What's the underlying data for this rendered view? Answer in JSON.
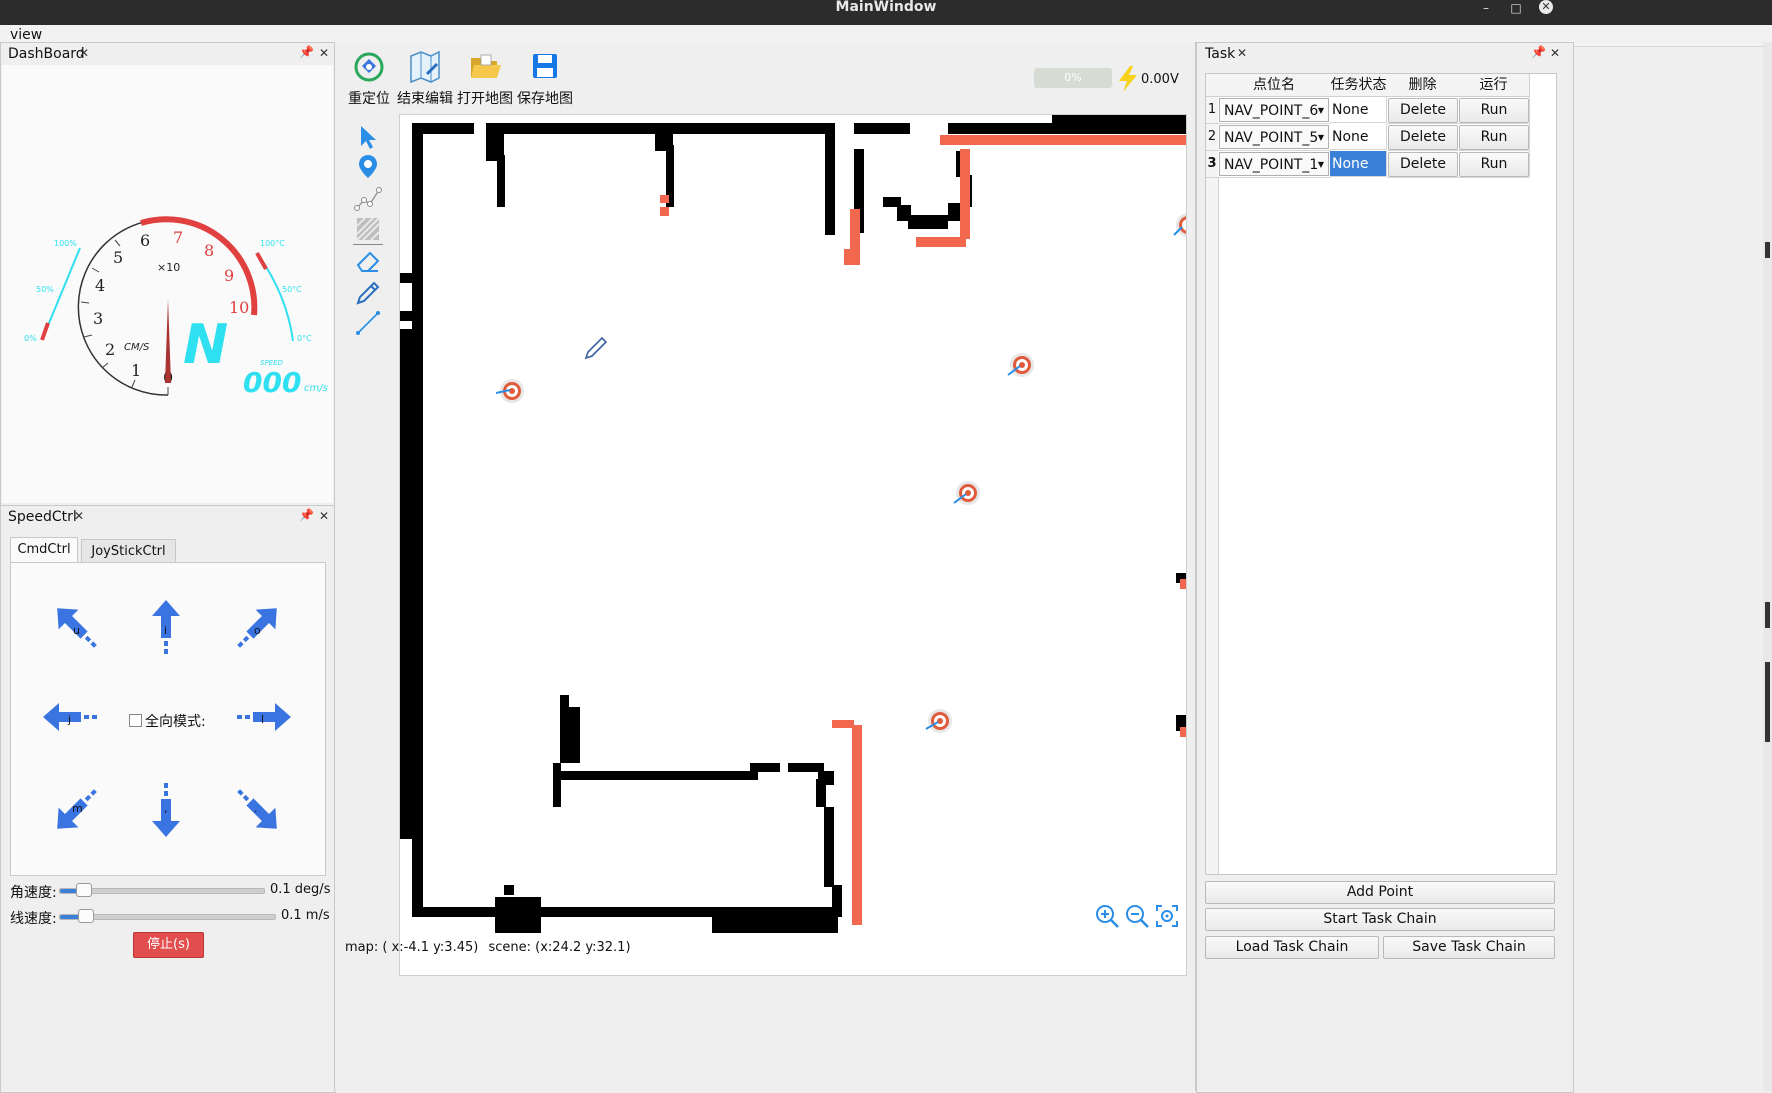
{
  "window": {
    "title": "MainWindow",
    "minimize": "–",
    "maximize": "□",
    "close": "✕"
  },
  "menubar": {
    "view": "view"
  },
  "dashboard": {
    "title": "DashBoard",
    "gauge": {
      "numbers": [
        "0",
        "1",
        "2",
        "3",
        "4",
        "5",
        "6",
        "7",
        "8",
        "9",
        "10"
      ],
      "multiplier": "×10",
      "unit": "CM/S",
      "gear": "N",
      "speed_label": "SPEED",
      "speed_value": "000",
      "speed_unit": "cm/s",
      "left_gauge_labels": [
        "100%",
        "50%",
        "0%"
      ],
      "right_gauge_labels": [
        "100°C",
        "50°C",
        "0°C"
      ]
    }
  },
  "speedctrl": {
    "title": "SpeedCtrl",
    "tabs": [
      "CmdCtrl",
      "JoyStickCtrl"
    ],
    "keys": {
      "nw": "u",
      "n": "i",
      "ne": "o",
      "w": "j",
      "e": "l",
      "sw": "m",
      "s": ",",
      "se": "."
    },
    "omni_label": "全向模式:",
    "angular_label": "角速度:",
    "angular_value": "0.1 deg/s",
    "angular_level": 0.12,
    "linear_label": "线速度:",
    "linear_value": "0.1 m/s",
    "linear_level": 0.12,
    "stop_label": "停止(s)"
  },
  "toolbar": {
    "buttons": [
      "重定位",
      "结束编辑",
      "打开地图",
      "保存地图"
    ],
    "battery_percent": "0%",
    "voltage": "0.00V"
  },
  "statusbar": {
    "map_label": "map:",
    "map_coords": "( x:-4.1 y:3.45)",
    "scene_label": "scene:",
    "scene_coords": "(x:24.2 y:32.1)"
  },
  "task": {
    "title": "Task",
    "columns": [
      "点位名",
      "任务状态",
      "删除",
      "运行"
    ],
    "rows": [
      {
        "index": "1",
        "point": "NAV_POINT_6",
        "status": "None",
        "delete": "Delete",
        "run": "Run"
      },
      {
        "index": "2",
        "point": "NAV_POINT_5",
        "status": "None",
        "delete": "Delete",
        "run": "Run"
      },
      {
        "index": "3",
        "point": "NAV_POINT_1",
        "status": "None",
        "delete": "Delete",
        "run": "Run"
      }
    ],
    "buttons": {
      "add_point": "Add Point",
      "start_chain": "Start Task Chain",
      "load_chain": "Load Task Chain",
      "save_chain": "Save Task Chain"
    }
  },
  "colors": {
    "accent_blue": "#3a74e0",
    "laser": "#f2684e",
    "selected": "#3b80d8",
    "gauge_cyan": "#2fe0f0",
    "gauge_red": "#e04040",
    "stop_red": "#e24d4d"
  }
}
